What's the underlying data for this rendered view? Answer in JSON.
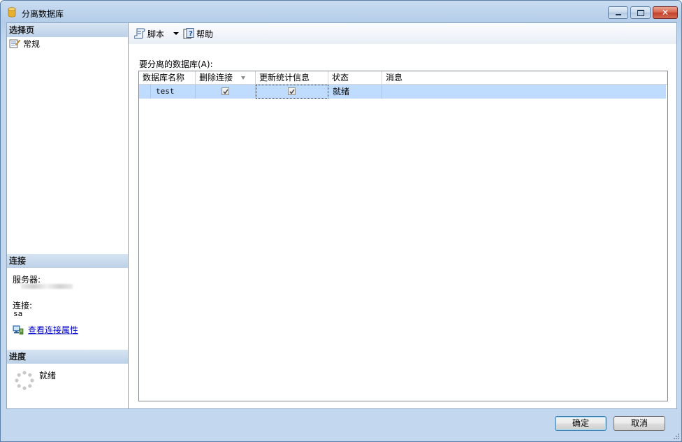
{
  "window": {
    "title": "分离数据库",
    "icons": {
      "app": "database-icon",
      "minimize": "minimize-icon",
      "maximize": "maximize-icon",
      "close": "close-icon"
    }
  },
  "sidebar": {
    "select_page_header": "选择页",
    "pages": [
      {
        "label": "常规",
        "icon": "general-page-icon"
      }
    ],
    "connection": {
      "header": "连接",
      "server_label": "服务器:",
      "connection_label": "连接:",
      "connection_value": "sa",
      "view_properties_link": "查看连接属性",
      "link_icon": "connection-properties-icon"
    },
    "progress": {
      "header": "进度",
      "status": "就绪",
      "icon": "progress-spinner-icon"
    }
  },
  "toolbar": {
    "script_label": "脚本",
    "script_icon": "script-icon",
    "help_label": "帮助",
    "help_icon": "help-icon"
  },
  "main": {
    "grid_caption": "要分离的数据库(A):",
    "columns": [
      "数据库名称",
      "删除连接",
      "更新统计信息",
      "状态",
      "消息"
    ],
    "rows": [
      {
        "name": "test",
        "drop_connections": true,
        "update_statistics": true,
        "status": "就绪",
        "message": ""
      }
    ]
  },
  "footer": {
    "ok_label": "确定",
    "cancel_label": "取消"
  },
  "colors": {
    "selection": "#bfdcff",
    "link": "#0000cc",
    "section_header": "#bcd1e8"
  }
}
